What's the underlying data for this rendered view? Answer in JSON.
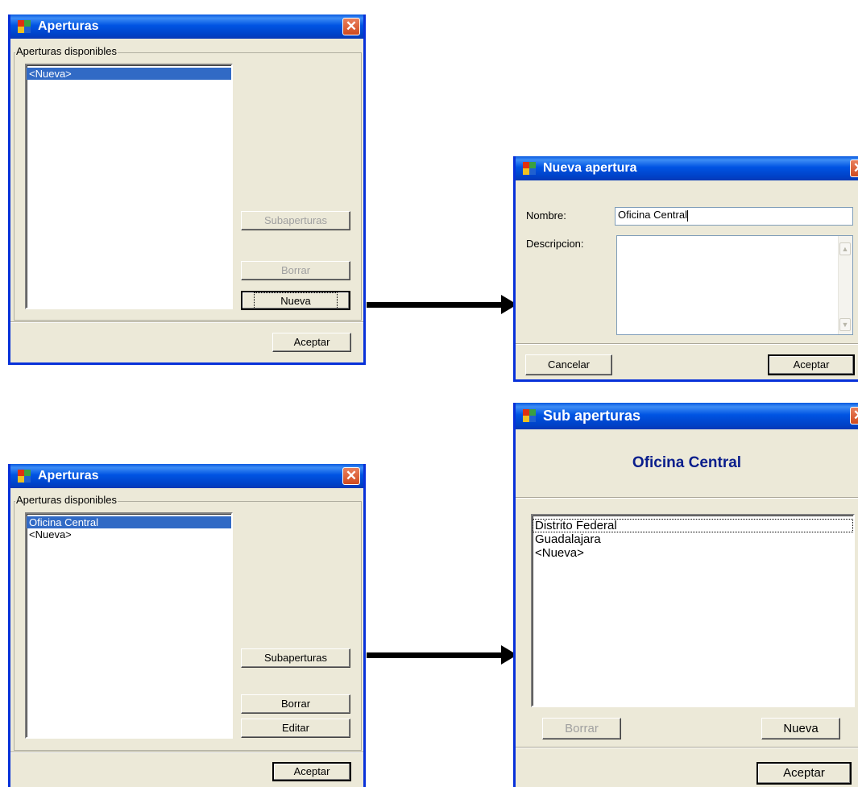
{
  "apertures_window_1": {
    "title": "Aperturas",
    "close_icon": "close-x-icon",
    "group_label": "Aperturas disponibles",
    "list_items": [
      "<Nueva>"
    ],
    "buttons": {
      "subaperturas": "Subaperturas",
      "borrar": "Borrar",
      "nueva": "Nueva",
      "aceptar": "Aceptar"
    }
  },
  "nueva_apertura_window": {
    "title": "Nueva apertura",
    "nombre_label": "Nombre:",
    "nombre_value": "Oficina Central",
    "descripcion_label": "Descripcion:",
    "descripcion_value": "",
    "buttons": {
      "cancelar": "Cancelar",
      "aceptar": "Aceptar"
    }
  },
  "apertures_window_2": {
    "title": "Aperturas",
    "group_label": "Aperturas disponibles",
    "list_items": [
      "Oficina Central",
      "<Nueva>"
    ],
    "buttons": {
      "subaperturas": "Subaperturas",
      "borrar": "Borrar",
      "editar": "Editar",
      "aceptar": "Aceptar"
    }
  },
  "sub_aperturas_window": {
    "title": "Sub aperturas",
    "heading": "Oficina Central",
    "list_items": [
      "Distrito Federal",
      "Guadalajara",
      "<Nueva>"
    ],
    "buttons": {
      "borrar": "Borrar",
      "nueva": "Nueva",
      "aceptar": "Aceptar"
    }
  },
  "colors": {
    "titlebar": "#0054e3",
    "window_face": "#ece9d8",
    "selection": "#316ac5",
    "heading_text": "#0a1e8c",
    "close_button": "#d04a1e"
  },
  "icons": [
    "app-icon",
    "close-icon",
    "arrow-right-icon",
    "scroll-up-icon",
    "scroll-down-icon"
  ]
}
